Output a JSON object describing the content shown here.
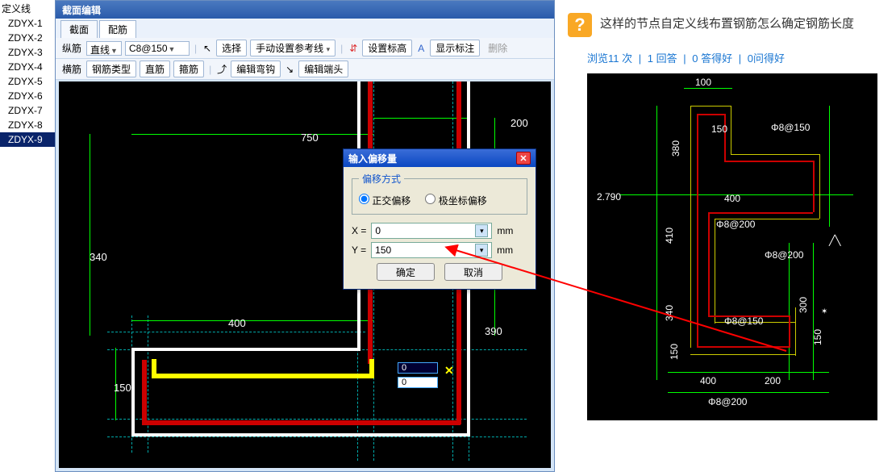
{
  "tree": {
    "title": "定义线",
    "items": [
      "ZDYX-1",
      "ZDYX-2",
      "ZDYX-3",
      "ZDYX-4",
      "ZDYX-5",
      "ZDYX-6",
      "ZDYX-7",
      "ZDYX-8",
      "ZDYX-9"
    ],
    "selected_index": 8
  },
  "editor": {
    "title": "截面编辑",
    "tabs": [
      "截面",
      "配筋"
    ],
    "active_tab": 1,
    "toolbar1": {
      "label_zongjin": "纵筋",
      "combo_linetype": "直线",
      "combo_spec": "C8@150",
      "btn_select": "选择",
      "btn_manualref": "手动设置参考线",
      "btn_sethight": "设置标高",
      "btn_showlabel": "显示标注",
      "btn_delete": "删除"
    },
    "toolbar2": {
      "label_hengjin": "横筋",
      "btn_gangjintype": "钢筋类型",
      "btn_zhijin": "直筋",
      "btn_gujin": "箍筋",
      "btn_editwangou": "编辑弯钩",
      "btn_editduantou": "编辑端头"
    }
  },
  "cad": {
    "dim_750": "750",
    "dim_200": "200",
    "dim_340": "340",
    "dim_400": "400",
    "dim_390": "390",
    "dim_150": "150",
    "val_box1": "0",
    "val_box2": "0"
  },
  "dialog": {
    "title": "输入偏移量",
    "group_label": "偏移方式",
    "radio1": "正交偏移",
    "radio2": "极坐标偏移",
    "x_label": "X =",
    "x_value": "0",
    "y_label": "Y =",
    "y_value": "150",
    "unit": "mm",
    "ok": "确定",
    "cancel": "取消"
  },
  "right": {
    "question_title": "这样的节点自定义线布置钢筋怎么确定钢筋长度",
    "stat_view_count": "浏览11 次",
    "stat_answer_count": "1 回答",
    "stat_good_answer": "0 答得好",
    "stat_good_question": "0问得好"
  },
  "ref": {
    "d100": "100",
    "d150a": "150",
    "d380": "380",
    "d2_790": "2.790",
    "d400a": "400",
    "d410": "410",
    "d340": "340",
    "d300": "300",
    "d150b": "150",
    "d400b": "400",
    "d200": "200",
    "d150c": "150",
    "t_c8_150_top": "Φ8@150",
    "t_c8_200_a": "Φ8@200",
    "t_c8_200_b": "Φ8@200",
    "t_c8_150_mid": "Φ8@150",
    "t_c8_200_c": "Φ8@200"
  }
}
